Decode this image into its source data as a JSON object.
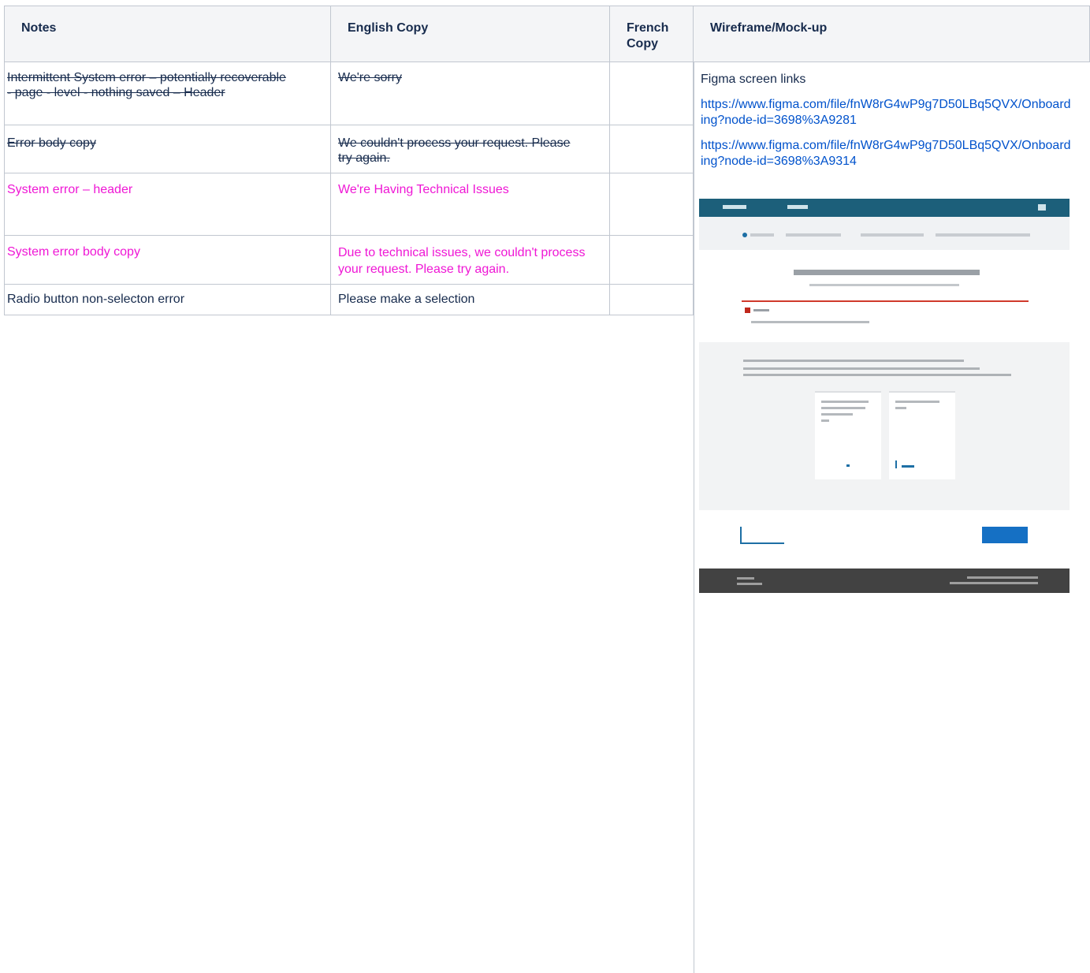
{
  "headers": {
    "notes": "Notes",
    "english": "English Copy",
    "french": "French Copy",
    "mockup": "Wireframe/Mock-up"
  },
  "rows": [
    {
      "notes": "Intermittent System error – potentially recoverable - page - level - nothing saved – Header",
      "english": "We're sorry",
      "french": "",
      "style": "strike"
    },
    {
      "notes": "Error body copy",
      "english": "We couldn't process your request. Please try again.",
      "french": "",
      "style": "strike"
    },
    {
      "notes": "System error – header",
      "english": "We're Having Technical Issues",
      "french": "",
      "style": "pink"
    },
    {
      "notes": "System error body copy",
      "english": "Due to technical issues, we couldn't process your request. Please try again.",
      "french": "",
      "style": "pink"
    },
    {
      "notes": "Radio button non-selecton error",
      "english": "Please make a selection",
      "french": "",
      "style": "normal"
    }
  ],
  "mockup": {
    "label": "Figma screen links",
    "links": [
      "https://www.figma.com/file/fnW8rG4wP9g7D50LBq5QVX/Onboarding?node-id=3698%3A9281",
      "https://www.figma.com/file/fnW8rG4wP9g7D50LBq5QVX/Onboarding?node-id=3698%3A9314"
    ],
    "image_icon": "wireframe-screenshot"
  },
  "colors": {
    "header_bg": "#f4f5f7",
    "border": "#c1c7d0",
    "link": "#0052cc",
    "pink_text": "#ef17d5",
    "mock_nav": "#1c5f7a",
    "mock_error": "#d0392b",
    "mock_button": "#1570c4"
  }
}
